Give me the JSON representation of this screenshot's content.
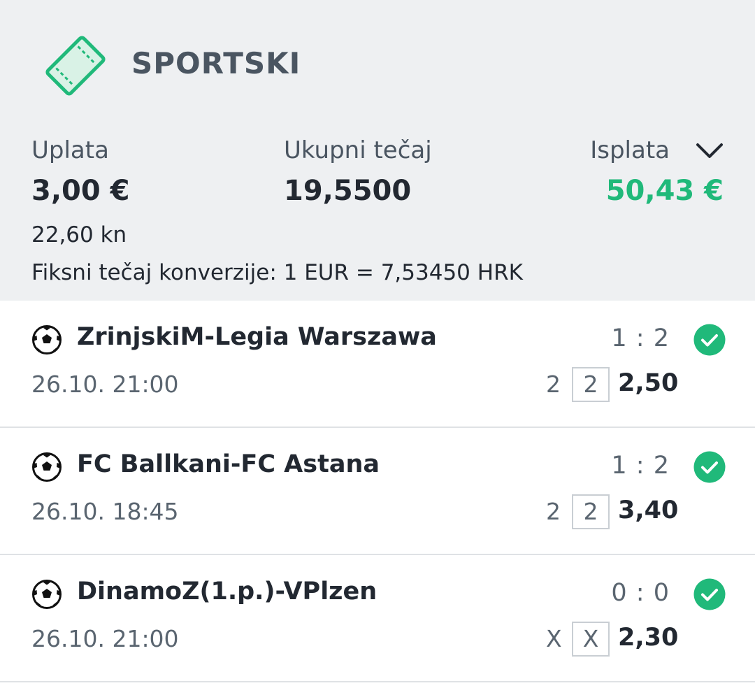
{
  "header": {
    "title": "SPORTSKI",
    "icon": "ticket-icon",
    "accent_color": "#20b97a"
  },
  "summary": {
    "stake_label": "Uplata",
    "stake_value": "3,00 €",
    "total_odds_label": "Ukupni tečaj",
    "total_odds_value": "19,5500",
    "payout_label": "Isplata",
    "payout_value": "50,43 €",
    "stake_kn": "22,60 kn",
    "conversion_note": "Fiksni tečaj konverzije: 1 EUR = 7,53450 HRK"
  },
  "events": [
    {
      "sport_icon": "soccer-ball-icon",
      "match": "ZrinjskiM-Legia Warszawa",
      "score": "1 : 2",
      "datetime": "26.10. 21:00",
      "tip": "2",
      "pick": "2",
      "odds": "2,50",
      "status_icon": "check-icon"
    },
    {
      "sport_icon": "soccer-ball-icon",
      "match": "FC Ballkani-FC Astana",
      "score": "1 : 2",
      "datetime": "26.10. 18:45",
      "tip": "2",
      "pick": "2",
      "odds": "3,40",
      "status_icon": "check-icon"
    },
    {
      "sport_icon": "soccer-ball-icon",
      "match": "DinamoZ(1.p.)-VPlzen",
      "score": "0 : 0",
      "datetime": "26.10. 21:00",
      "tip": "X",
      "pick": "X",
      "odds": "2,30",
      "status_icon": "check-icon"
    }
  ]
}
